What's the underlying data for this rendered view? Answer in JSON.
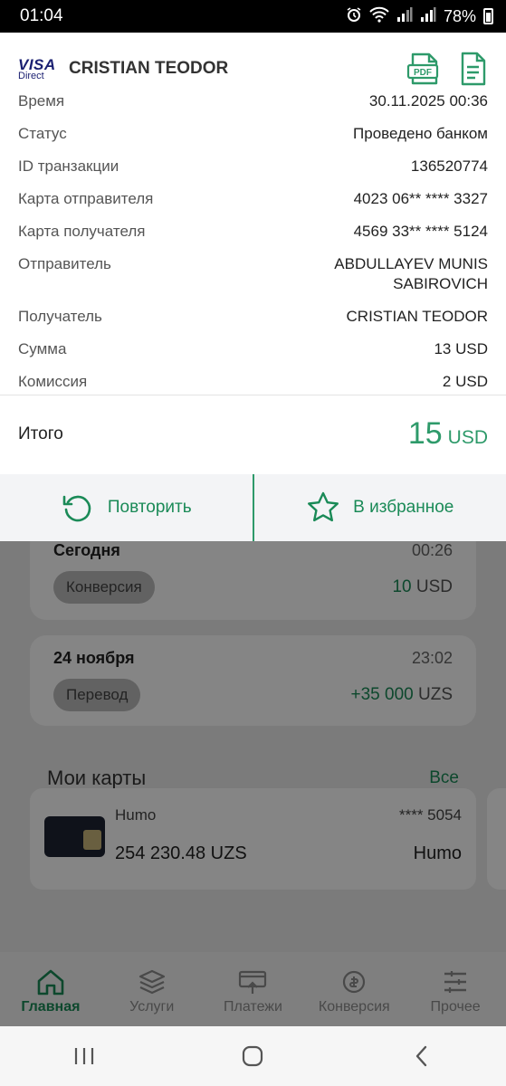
{
  "status_bar": {
    "time": "01:04",
    "battery": "78%"
  },
  "sheet": {
    "brand_line1": "VISA",
    "brand_line2": "Direct",
    "recipient": "CRISTIAN TEODOR",
    "pdf_icon": "pdf-file-icon",
    "receipt_icon": "receipt-icon",
    "rows": [
      {
        "label": "Время",
        "value": "30.11.2025 00:36"
      },
      {
        "label": "Статус",
        "value": "Проведено банком"
      },
      {
        "label": "ID транзакции",
        "value": "136520774"
      },
      {
        "label": "Карта отправителя",
        "value": "4023 06** **** 3327"
      },
      {
        "label": "Карта получателя",
        "value": "4569 33** **** 5124"
      },
      {
        "label": "Отправитель",
        "value": "ABDULLAYEV MUNIS SABIROVICH"
      },
      {
        "label": "Получатель",
        "value": "CRISTIAN TEODOR"
      },
      {
        "label": "Сумма",
        "value": "13 USD"
      },
      {
        "label": "Комиссия",
        "value": "2 USD"
      }
    ],
    "total": {
      "label": "Итого",
      "amount": "15",
      "currency": "USD"
    },
    "actions": {
      "repeat": "Повторить",
      "favorite": "В избранное"
    }
  },
  "history": [
    {
      "date": "Сегодня",
      "time": "00:26",
      "type": "Конверсия",
      "amount": "10",
      "currency": "USD"
    },
    {
      "date": "24 ноября",
      "time": "23:02",
      "type": "Перевод",
      "amount": "+35 000",
      "currency": "UZS"
    }
  ],
  "my_cards": {
    "title": "Мои карты",
    "all": "Все",
    "card": {
      "name": "Humo",
      "mask": "**** 5054",
      "balance": "254 230.48 UZS",
      "brand": "Humo"
    }
  },
  "bottom_nav": [
    {
      "label": "Главная",
      "icon": "home-icon",
      "active": true
    },
    {
      "label": "Услуги",
      "icon": "layers-icon",
      "active": false
    },
    {
      "label": "Платежи",
      "icon": "payment-icon",
      "active": false
    },
    {
      "label": "Конверсия",
      "icon": "exchange-icon",
      "active": false
    },
    {
      "label": "Прочее",
      "icon": "menu-icon",
      "active": false
    }
  ],
  "colors": {
    "accent": "#1a8a57",
    "total": "#2e9a6a"
  }
}
